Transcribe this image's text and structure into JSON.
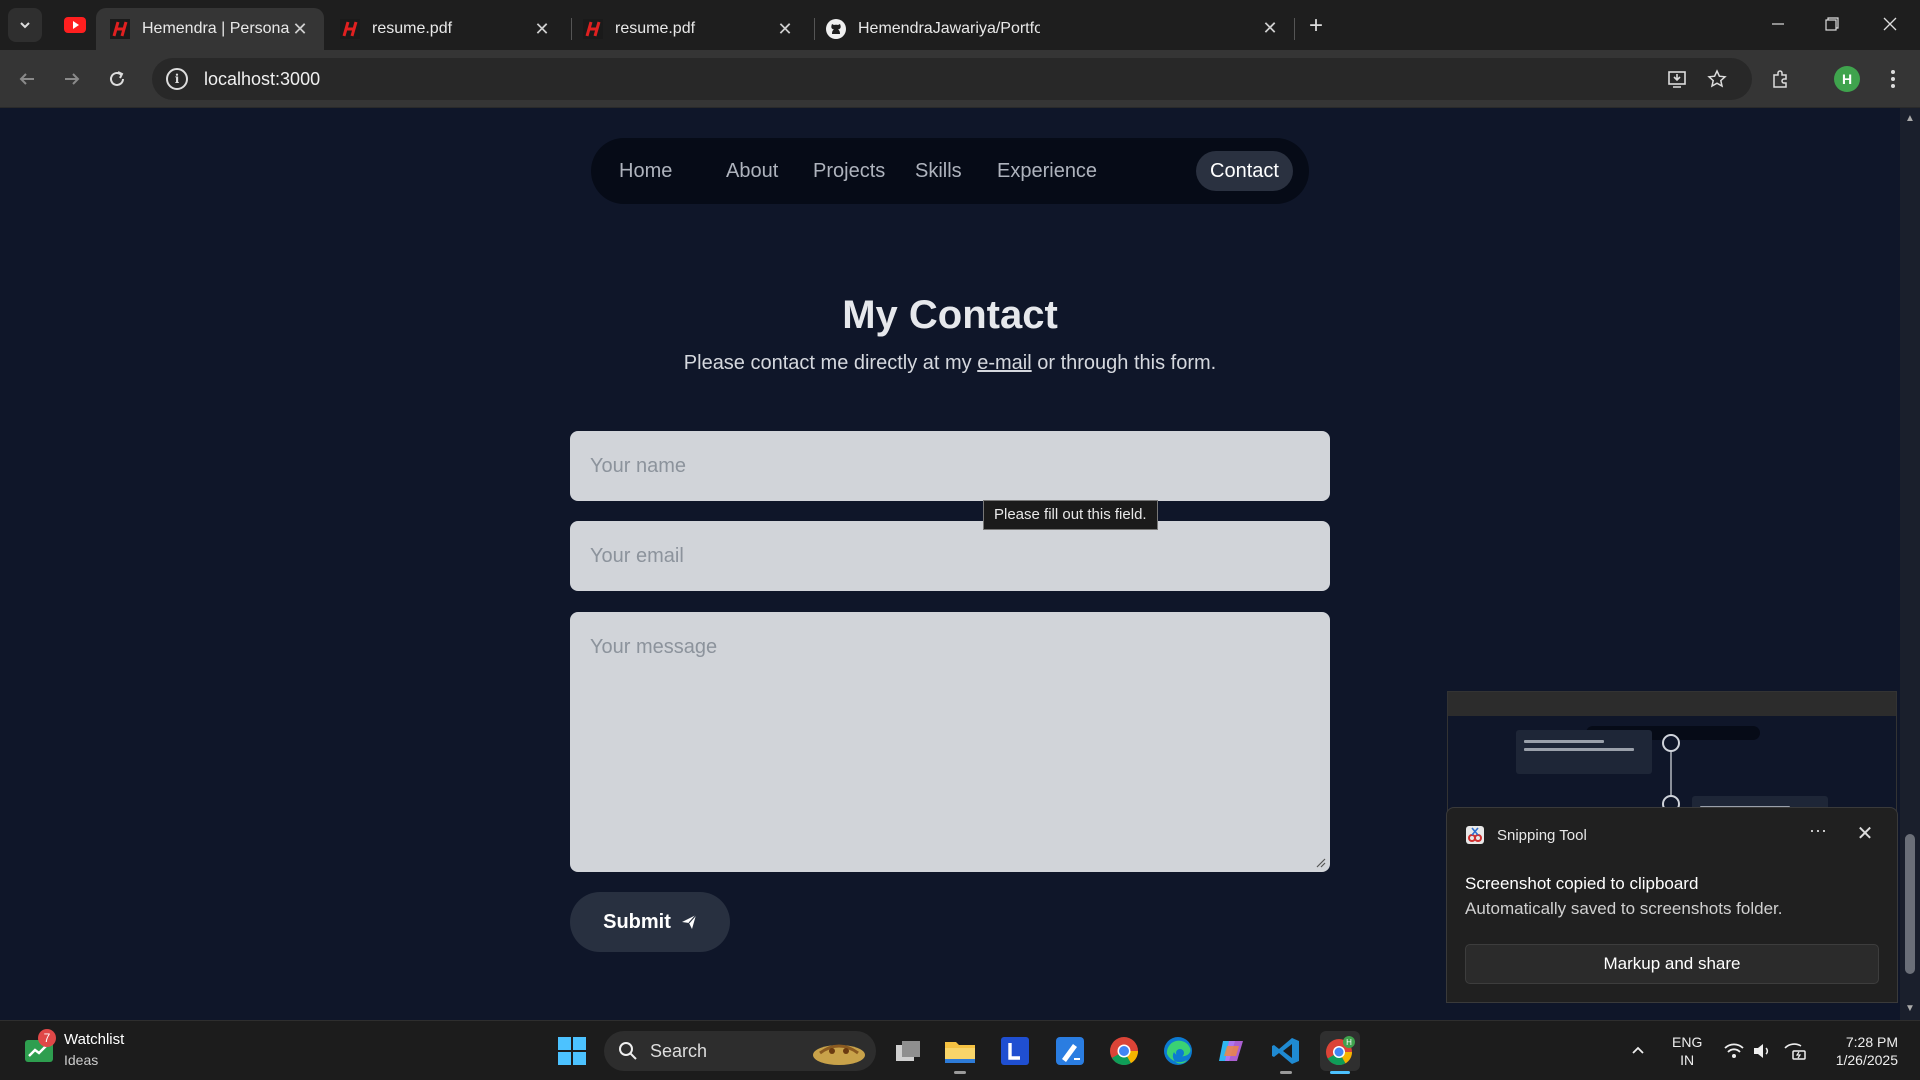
{
  "browser": {
    "tabs": [
      {
        "title": "Hemendra | Personal Portfolio",
        "icon": "hemendra-logo-icon",
        "active": true
      },
      {
        "title": "resume.pdf",
        "icon": "hemendra-logo-icon",
        "active": false
      },
      {
        "title": "resume.pdf",
        "icon": "hemendra-logo-icon",
        "active": false
      },
      {
        "title": "HemendraJawariya/Portfolio",
        "icon": "github-icon",
        "active": false
      }
    ],
    "url": "localhost:3000",
    "profile_initial": "H"
  },
  "nav": {
    "items": [
      "Home",
      "About",
      "Projects",
      "Skills",
      "Experience",
      "Contact"
    ],
    "active": "Contact"
  },
  "contact": {
    "title": "My Contact",
    "subtitle_before": "Please contact me directly at my ",
    "email_link": "e-mail",
    "subtitle_after": " or through this form.",
    "name_placeholder": "Your name",
    "email_placeholder": "Your email",
    "message_placeholder": "Your message",
    "submit_label": "Submit",
    "validation_tooltip": "Please fill out this field."
  },
  "toast": {
    "app_name": "Snipping Tool",
    "message": "Screenshot copied to clipboard",
    "detail": "Automatically saved to screenshots folder.",
    "action_label": "Markup and share"
  },
  "taskbar": {
    "widget_title": "Watchlist",
    "widget_subtitle": "Ideas",
    "widget_badge": "7",
    "search_label": "Search",
    "language": "ENG",
    "region": "IN",
    "time": "7:28 PM",
    "date": "1/26/2025"
  },
  "colors": {
    "page_background": "#0f1629",
    "nav_pill": "#060b17",
    "input_background": "#d1d4d9",
    "submit_background": "#283040"
  }
}
